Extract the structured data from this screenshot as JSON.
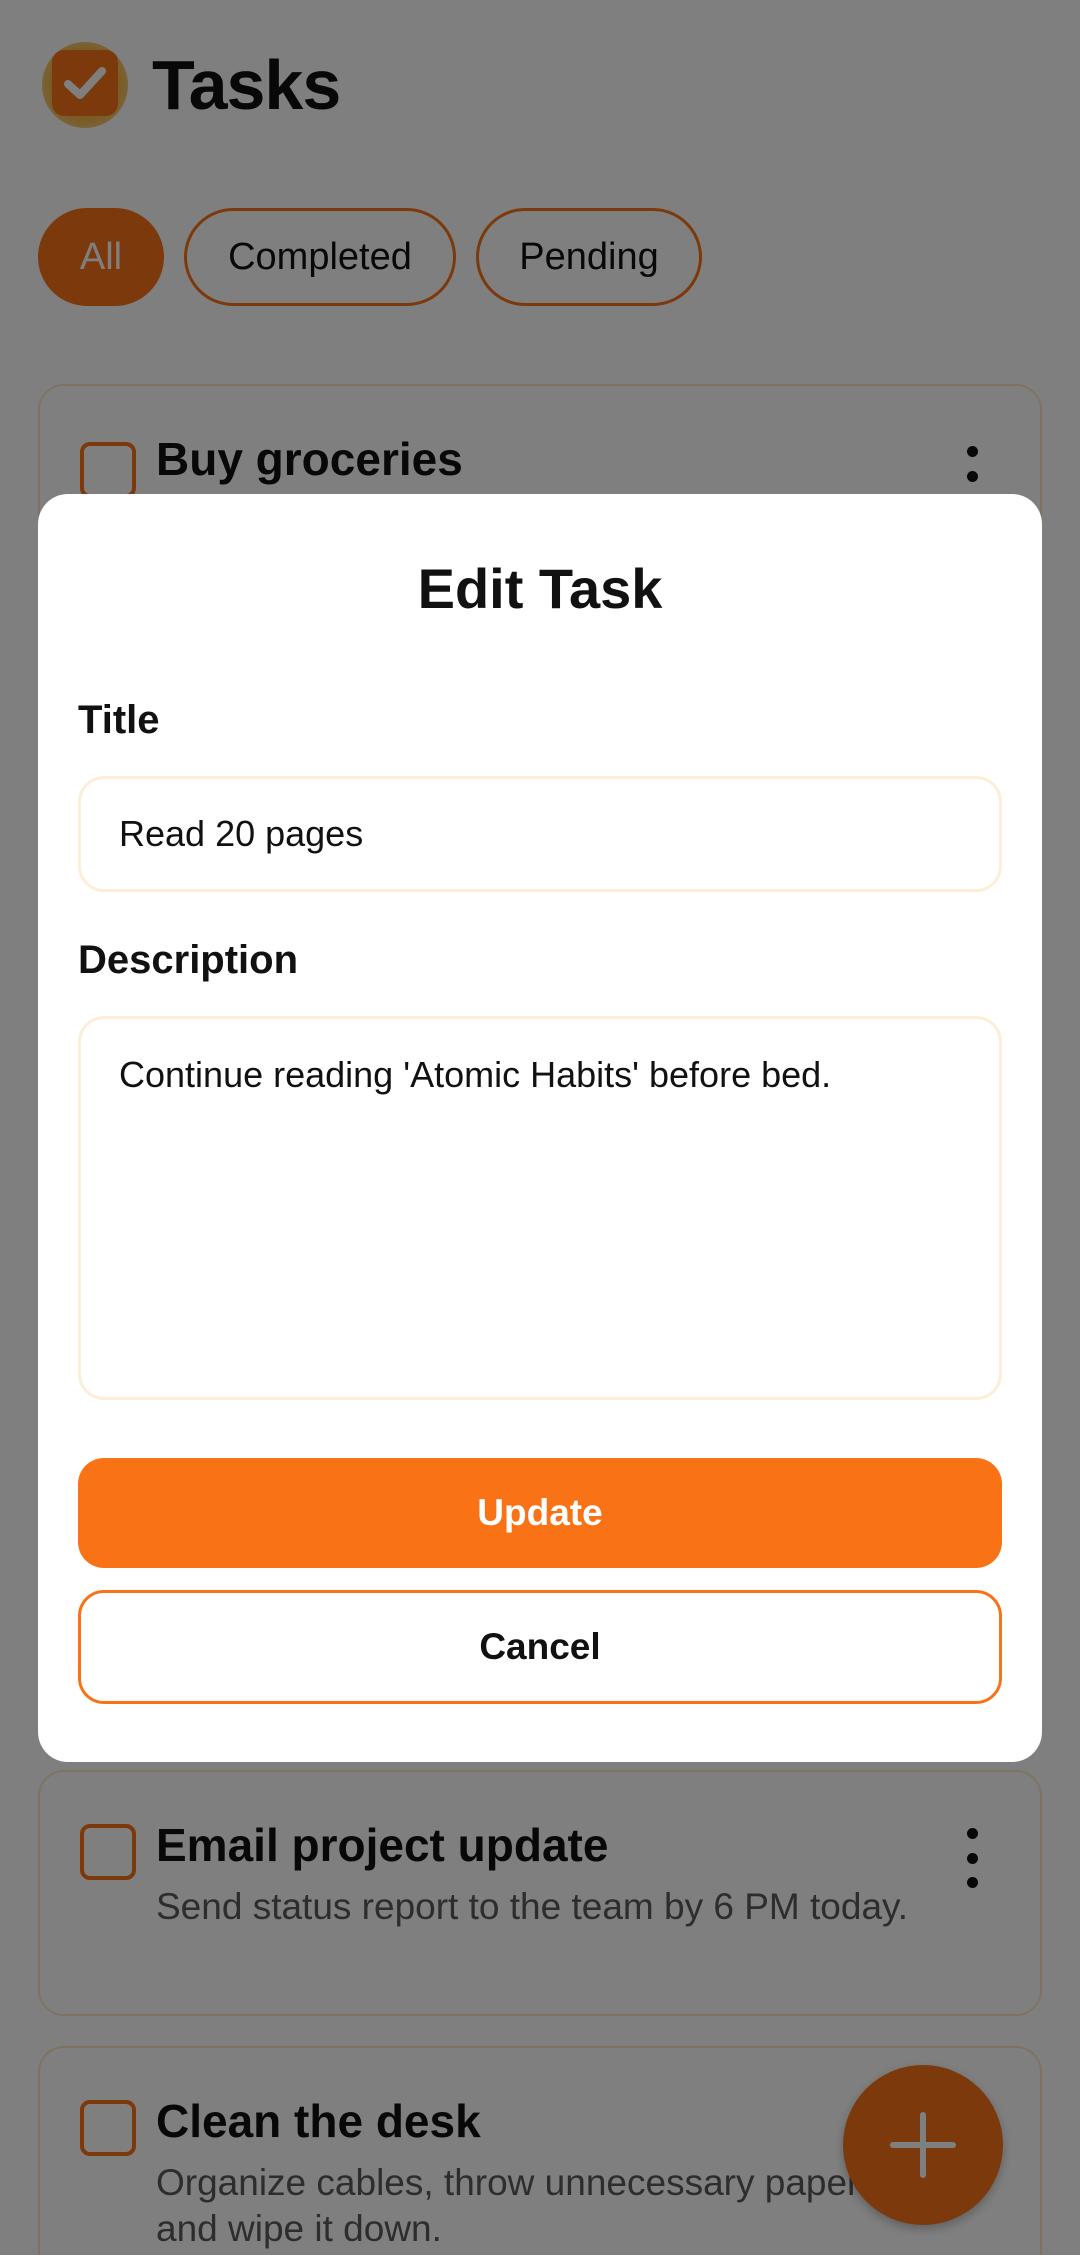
{
  "app": {
    "title": "Tasks",
    "logo_icon": "check-icon"
  },
  "filters": [
    {
      "label": "All",
      "active": true
    },
    {
      "label": "Completed",
      "active": false
    },
    {
      "label": "Pending",
      "active": false
    }
  ],
  "tasks": [
    {
      "title": "Buy groceries",
      "description": "",
      "completed": false
    },
    {
      "title": "Email project update",
      "description": "Send status report to the team by 6 PM today.",
      "completed": false
    },
    {
      "title": "Clean the desk",
      "description": "Organize cables, throw unnecessary papers, and wipe it down.",
      "completed": false
    }
  ],
  "fab": {
    "icon": "plus-icon"
  },
  "dialog": {
    "title": "Edit Task",
    "title_label": "Title",
    "title_value": "Read 20 pages",
    "description_label": "Description",
    "description_value": "Continue reading 'Atomic Habits' before bed.",
    "update_label": "Update",
    "cancel_label": "Cancel"
  },
  "colors": {
    "accent": "#f97316",
    "scrim": "rgba(0,0,0,0.5)",
    "card_border": "#fde7c3"
  }
}
